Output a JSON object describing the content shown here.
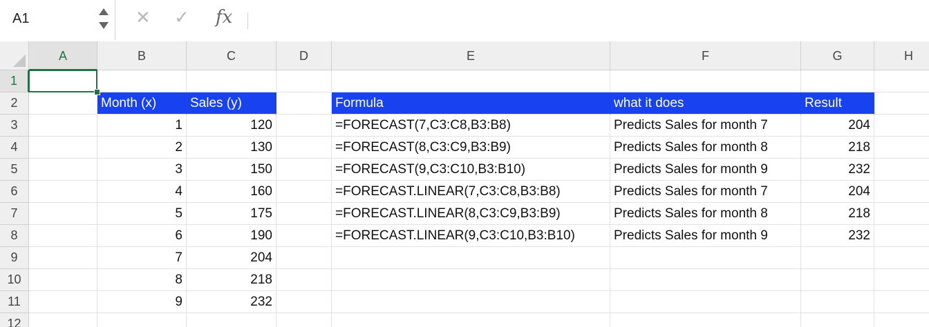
{
  "formula_bar": {
    "name_box": "A1",
    "cancel_icon": "✕",
    "confirm_icon": "✓",
    "fx_label": "fx",
    "formula": ""
  },
  "columns": [
    "A",
    "B",
    "C",
    "D",
    "E",
    "F",
    "G",
    "H"
  ],
  "rows": [
    "1",
    "2",
    "3",
    "4",
    "5",
    "6",
    "7",
    "8",
    "9",
    "10",
    "11",
    "12"
  ],
  "active_cell": "A1",
  "colors": {
    "header_fill": "#1841f0",
    "header_text": "#ffffff",
    "selection": "#217346"
  },
  "cells": {
    "B2": "Month (x)",
    "C2": "Sales (y)",
    "B3": "1",
    "C3": "120",
    "B4": "2",
    "C4": "130",
    "B5": "3",
    "C5": "150",
    "B6": "4",
    "C6": "160",
    "B7": "5",
    "C7": "175",
    "B8": "6",
    "C8": "190",
    "B9": "7",
    "C9": "204",
    "B10": "8",
    "C10": "218",
    "B11": "9",
    "C11": "232",
    "E2": "Formula",
    "F2": "what it does",
    "G2": "Result",
    "E3": "=FORECAST(7,C3:C8,B3:B8)",
    "F3": "Predicts Sales for month 7",
    "G3": "204",
    "E4": "=FORECAST(8,C3:C9,B3:B9)",
    "F4": "Predicts Sales for month 8",
    "G4": "218",
    "E5": "=FORECAST(9,C3:C10,B3:B10)",
    "F5": "Predicts Sales for month 9",
    "G5": "232",
    "E6": "=FORECAST.LINEAR(7,C3:C8,B3:B8)",
    "F6": "Predicts Sales for month 7",
    "G6": "204",
    "E7": "=FORECAST.LINEAR(8,C3:C9,B3:B9)",
    "F7": "Predicts Sales for month 8",
    "G7": "218",
    "E8": "=FORECAST.LINEAR(9,C3:C10,B3:B10)",
    "F8": "Predicts Sales for month 9",
    "G8": "232"
  }
}
